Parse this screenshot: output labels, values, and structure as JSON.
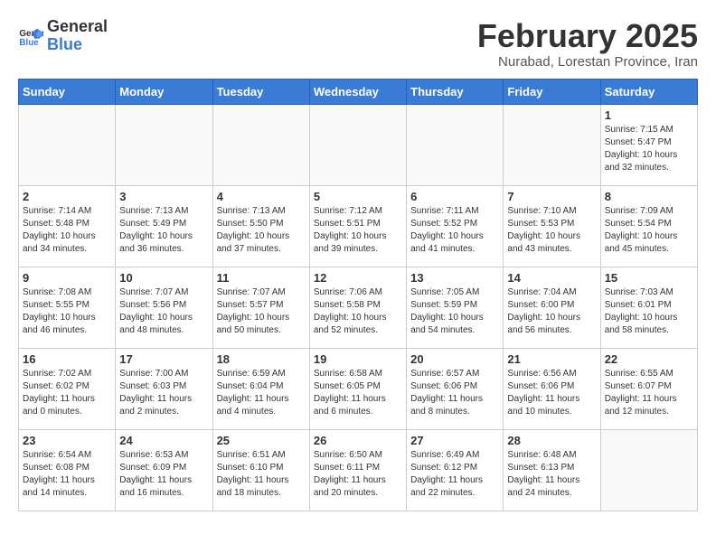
{
  "logo": {
    "line1": "General",
    "line2": "Blue"
  },
  "title": "February 2025",
  "location": "Nurabad, Lorestan Province, Iran",
  "days_of_week": [
    "Sunday",
    "Monday",
    "Tuesday",
    "Wednesday",
    "Thursday",
    "Friday",
    "Saturday"
  ],
  "weeks": [
    [
      {
        "day": "",
        "info": ""
      },
      {
        "day": "",
        "info": ""
      },
      {
        "day": "",
        "info": ""
      },
      {
        "day": "",
        "info": ""
      },
      {
        "day": "",
        "info": ""
      },
      {
        "day": "",
        "info": ""
      },
      {
        "day": "1",
        "info": "Sunrise: 7:15 AM\nSunset: 5:47 PM\nDaylight: 10 hours\nand 32 minutes."
      }
    ],
    [
      {
        "day": "2",
        "info": "Sunrise: 7:14 AM\nSunset: 5:48 PM\nDaylight: 10 hours\nand 34 minutes."
      },
      {
        "day": "3",
        "info": "Sunrise: 7:13 AM\nSunset: 5:49 PM\nDaylight: 10 hours\nand 36 minutes."
      },
      {
        "day": "4",
        "info": "Sunrise: 7:13 AM\nSunset: 5:50 PM\nDaylight: 10 hours\nand 37 minutes."
      },
      {
        "day": "5",
        "info": "Sunrise: 7:12 AM\nSunset: 5:51 PM\nDaylight: 10 hours\nand 39 minutes."
      },
      {
        "day": "6",
        "info": "Sunrise: 7:11 AM\nSunset: 5:52 PM\nDaylight: 10 hours\nand 41 minutes."
      },
      {
        "day": "7",
        "info": "Sunrise: 7:10 AM\nSunset: 5:53 PM\nDaylight: 10 hours\nand 43 minutes."
      },
      {
        "day": "8",
        "info": "Sunrise: 7:09 AM\nSunset: 5:54 PM\nDaylight: 10 hours\nand 45 minutes."
      }
    ],
    [
      {
        "day": "9",
        "info": "Sunrise: 7:08 AM\nSunset: 5:55 PM\nDaylight: 10 hours\nand 46 minutes."
      },
      {
        "day": "10",
        "info": "Sunrise: 7:07 AM\nSunset: 5:56 PM\nDaylight: 10 hours\nand 48 minutes."
      },
      {
        "day": "11",
        "info": "Sunrise: 7:07 AM\nSunset: 5:57 PM\nDaylight: 10 hours\nand 50 minutes."
      },
      {
        "day": "12",
        "info": "Sunrise: 7:06 AM\nSunset: 5:58 PM\nDaylight: 10 hours\nand 52 minutes."
      },
      {
        "day": "13",
        "info": "Sunrise: 7:05 AM\nSunset: 5:59 PM\nDaylight: 10 hours\nand 54 minutes."
      },
      {
        "day": "14",
        "info": "Sunrise: 7:04 AM\nSunset: 6:00 PM\nDaylight: 10 hours\nand 56 minutes."
      },
      {
        "day": "15",
        "info": "Sunrise: 7:03 AM\nSunset: 6:01 PM\nDaylight: 10 hours\nand 58 minutes."
      }
    ],
    [
      {
        "day": "16",
        "info": "Sunrise: 7:02 AM\nSunset: 6:02 PM\nDaylight: 11 hours\nand 0 minutes."
      },
      {
        "day": "17",
        "info": "Sunrise: 7:00 AM\nSunset: 6:03 PM\nDaylight: 11 hours\nand 2 minutes."
      },
      {
        "day": "18",
        "info": "Sunrise: 6:59 AM\nSunset: 6:04 PM\nDaylight: 11 hours\nand 4 minutes."
      },
      {
        "day": "19",
        "info": "Sunrise: 6:58 AM\nSunset: 6:05 PM\nDaylight: 11 hours\nand 6 minutes."
      },
      {
        "day": "20",
        "info": "Sunrise: 6:57 AM\nSunset: 6:06 PM\nDaylight: 11 hours\nand 8 minutes."
      },
      {
        "day": "21",
        "info": "Sunrise: 6:56 AM\nSunset: 6:06 PM\nDaylight: 11 hours\nand 10 minutes."
      },
      {
        "day": "22",
        "info": "Sunrise: 6:55 AM\nSunset: 6:07 PM\nDaylight: 11 hours\nand 12 minutes."
      }
    ],
    [
      {
        "day": "23",
        "info": "Sunrise: 6:54 AM\nSunset: 6:08 PM\nDaylight: 11 hours\nand 14 minutes."
      },
      {
        "day": "24",
        "info": "Sunrise: 6:53 AM\nSunset: 6:09 PM\nDaylight: 11 hours\nand 16 minutes."
      },
      {
        "day": "25",
        "info": "Sunrise: 6:51 AM\nSunset: 6:10 PM\nDaylight: 11 hours\nand 18 minutes."
      },
      {
        "day": "26",
        "info": "Sunrise: 6:50 AM\nSunset: 6:11 PM\nDaylight: 11 hours\nand 20 minutes."
      },
      {
        "day": "27",
        "info": "Sunrise: 6:49 AM\nSunset: 6:12 PM\nDaylight: 11 hours\nand 22 minutes."
      },
      {
        "day": "28",
        "info": "Sunrise: 6:48 AM\nSunset: 6:13 PM\nDaylight: 11 hours\nand 24 minutes."
      },
      {
        "day": "",
        "info": ""
      }
    ]
  ]
}
